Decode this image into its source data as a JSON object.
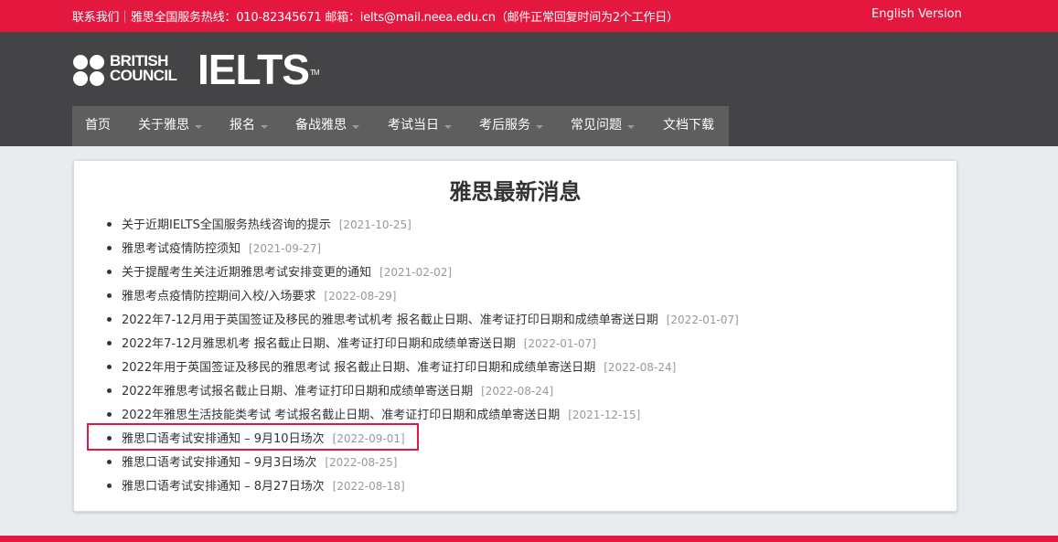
{
  "topbar": {
    "contact_text": "联系我们｜雅思全国服务热线：010-82345671   邮箱：ielts@mail.neea.edu.cn（邮件正常回复时间为2个工作日）",
    "english_version": "English Version"
  },
  "logo": {
    "british_council_line1": "BRITISH",
    "british_council_line2": "COUNCIL",
    "ielts": "IELTS",
    "trademark": "TM"
  },
  "nav": {
    "items": [
      {
        "label": "首页",
        "has_dropdown": false
      },
      {
        "label": "关于雅思",
        "has_dropdown": true
      },
      {
        "label": "报名",
        "has_dropdown": true
      },
      {
        "label": "备战雅思",
        "has_dropdown": true
      },
      {
        "label": "考试当日",
        "has_dropdown": true
      },
      {
        "label": "考后服务",
        "has_dropdown": true
      },
      {
        "label": "常见问题",
        "has_dropdown": true
      },
      {
        "label": "文档下载",
        "has_dropdown": false
      }
    ]
  },
  "news": {
    "title": "雅思最新消息",
    "items": [
      {
        "title": "关于近期IELTS全国服务热线咨询的提示",
        "date": "[2021-10-25]"
      },
      {
        "title": "雅思考试疫情防控须知",
        "date": "[2021-09-27]"
      },
      {
        "title": "关于提醒考生关注近期雅思考试安排变更的通知",
        "date": "[2021-02-02]"
      },
      {
        "title": "雅思考点疫情防控期间入校/入场要求",
        "date": "[2022-08-29]"
      },
      {
        "title": "2022年7-12月用于英国签证及移民的雅思考试机考 报名截止日期、准考证打印日期和成绩单寄送日期",
        "date": "[2022-01-07]"
      },
      {
        "title": "2022年7-12月雅思机考 报名截止日期、准考证打印日期和成绩单寄送日期",
        "date": "[2022-01-07]"
      },
      {
        "title": "2022年用于英国签证及移民的雅思考试 报名截止日期、准考证打印日期和成绩单寄送日期",
        "date": "[2022-08-24]"
      },
      {
        "title": "2022年雅思考试报名截止日期、准考证打印日期和成绩单寄送日期",
        "date": "[2022-08-24]"
      },
      {
        "title": "2022年雅思生活技能类考试 考试报名截止日期、准考证打印日期和成绩单寄送日期",
        "date": "[2021-12-15]"
      },
      {
        "title": "雅思口语考试安排通知 – 9月10日场次",
        "date": "[2022-09-01]",
        "highlighted": true
      },
      {
        "title": "雅思口语考试安排通知 – 9月3日场次",
        "date": "[2022-08-25]"
      },
      {
        "title": "雅思口语考试安排通知 – 8月27日场次",
        "date": "[2022-08-18]"
      }
    ]
  },
  "colors": {
    "brand_red": "#e4173e",
    "header_gray": "#444446",
    "nav_gray": "#5e5e5f",
    "page_bg": "#e9ecee",
    "date_gray": "#999999"
  }
}
